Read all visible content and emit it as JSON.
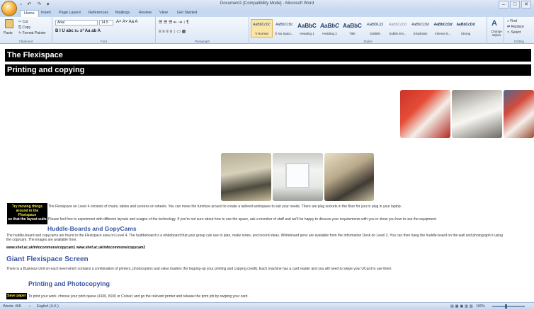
{
  "window": {
    "title": "Document1 [Compatibility Mode] - Microsoft Word",
    "qat": "▫ ↶ ↷ ▾",
    "controls": [
      "–",
      "□",
      "✕"
    ]
  },
  "tabs": [
    "Home",
    "Insert",
    "Page Layout",
    "References",
    "Mailings",
    "Review",
    "View",
    "Get Started"
  ],
  "ribbon": {
    "clipboard": {
      "label": "Clipboard",
      "paste": "Paste",
      "cut": "Cut",
      "copy": "Copy",
      "format_painter": "Format Painter"
    },
    "font": {
      "label": "Font",
      "name": "Arial",
      "size": "14.5",
      "tools_row1": "A˄ A˅  Aa  A",
      "tools_row2": "B  I  U  abc  x₂  x²  Aa   ab  A"
    },
    "paragraph": {
      "label": "Paragraph",
      "tools_row1": "☰  ☰  ☰   ⇤ ⇥   ↕  ¶",
      "tools_row2": "≡  ≡  ≡  ≡   ↕   ▭  ▦"
    },
    "styles": {
      "label": "Styles",
      "items": [
        {
          "sample": "AaBbCcDc",
          "name": "¶ Normal"
        },
        {
          "sample": "AaBbCcDc",
          "name": "¶ No Spaci..."
        },
        {
          "sample": "AaBbC",
          "name": "Heading 1"
        },
        {
          "sample": "AaBbC",
          "name": "Heading 2"
        },
        {
          "sample": "AaBbC",
          "name": "Title"
        },
        {
          "sample": "AaBbCcI",
          "name": "Subtitle"
        },
        {
          "sample": "AaBbCcDd",
          "name": "Subtle Em..."
        },
        {
          "sample": "AaBbCcDd",
          "name": "Emphasis"
        },
        {
          "sample": "AaBbCcDd",
          "name": "Intense E..."
        },
        {
          "sample": "AaBbCcDd",
          "name": "Strong"
        }
      ],
      "change_styles": "Change Styles"
    },
    "editing": {
      "label": "Editing",
      "find": "Find",
      "replace": "Replace",
      "select": "Select"
    }
  },
  "document": {
    "title_banner": "The Flexispace",
    "subtitle_banner": "Printing and copying",
    "moving_box": [
      "Try moving things",
      "around in the",
      "Flexispace",
      "so that the layout suits"
    ],
    "para1": "The Flexispace on Level 4 consists of chairs, tables and screens on wheels. You can move the furniture around to create a tailored workspace to suit your needs. There are plug sockets in the floor for you to plug in your laptop.",
    "para2": "Please feel free to experiment with different layouts and usages of the technology. If you're not sure about how to use the space, ask a member of staff and we'll be happy to discuss your requirements with you or show you how to use the equipment.",
    "heading_huddle": "Huddle-Boards and GopyCams",
    "para3": "The huddle-board and copycams are found in the Flexispace area on Level 4. The huddleboard is a whiteboard that your group can use to plan, make notes, and record ideas. Whiteboard pens are available from the Information Desk on Level 2. You can then hang the huddle-board on the wall and photograph it using",
    "para3b": "the copycam. The images are available from:",
    "links": "www.shef.ac.uk/infocommons/copycam1   www.shef.ac.uk/infocommons/copycam2",
    "heading_giant": "Giant Flexispace Screen",
    "para4": "There is a Business Unit on each level which contains a combination of printers, photocopiers and value loaders (for topping-up your printing and copying credit). Each machine has a card reader and you will need to swipe your UCard to use them.",
    "heading_print": "Printing and Photocopying",
    "save_paper": "Save paper",
    "para5": "To print your work, choose your print queue (4100, 8100 or Colour) and go the relevant printer and release the print job by swiping your card."
  },
  "status": {
    "words": "Words: 468",
    "language": "English (U.K.)",
    "zoom": "100%"
  }
}
